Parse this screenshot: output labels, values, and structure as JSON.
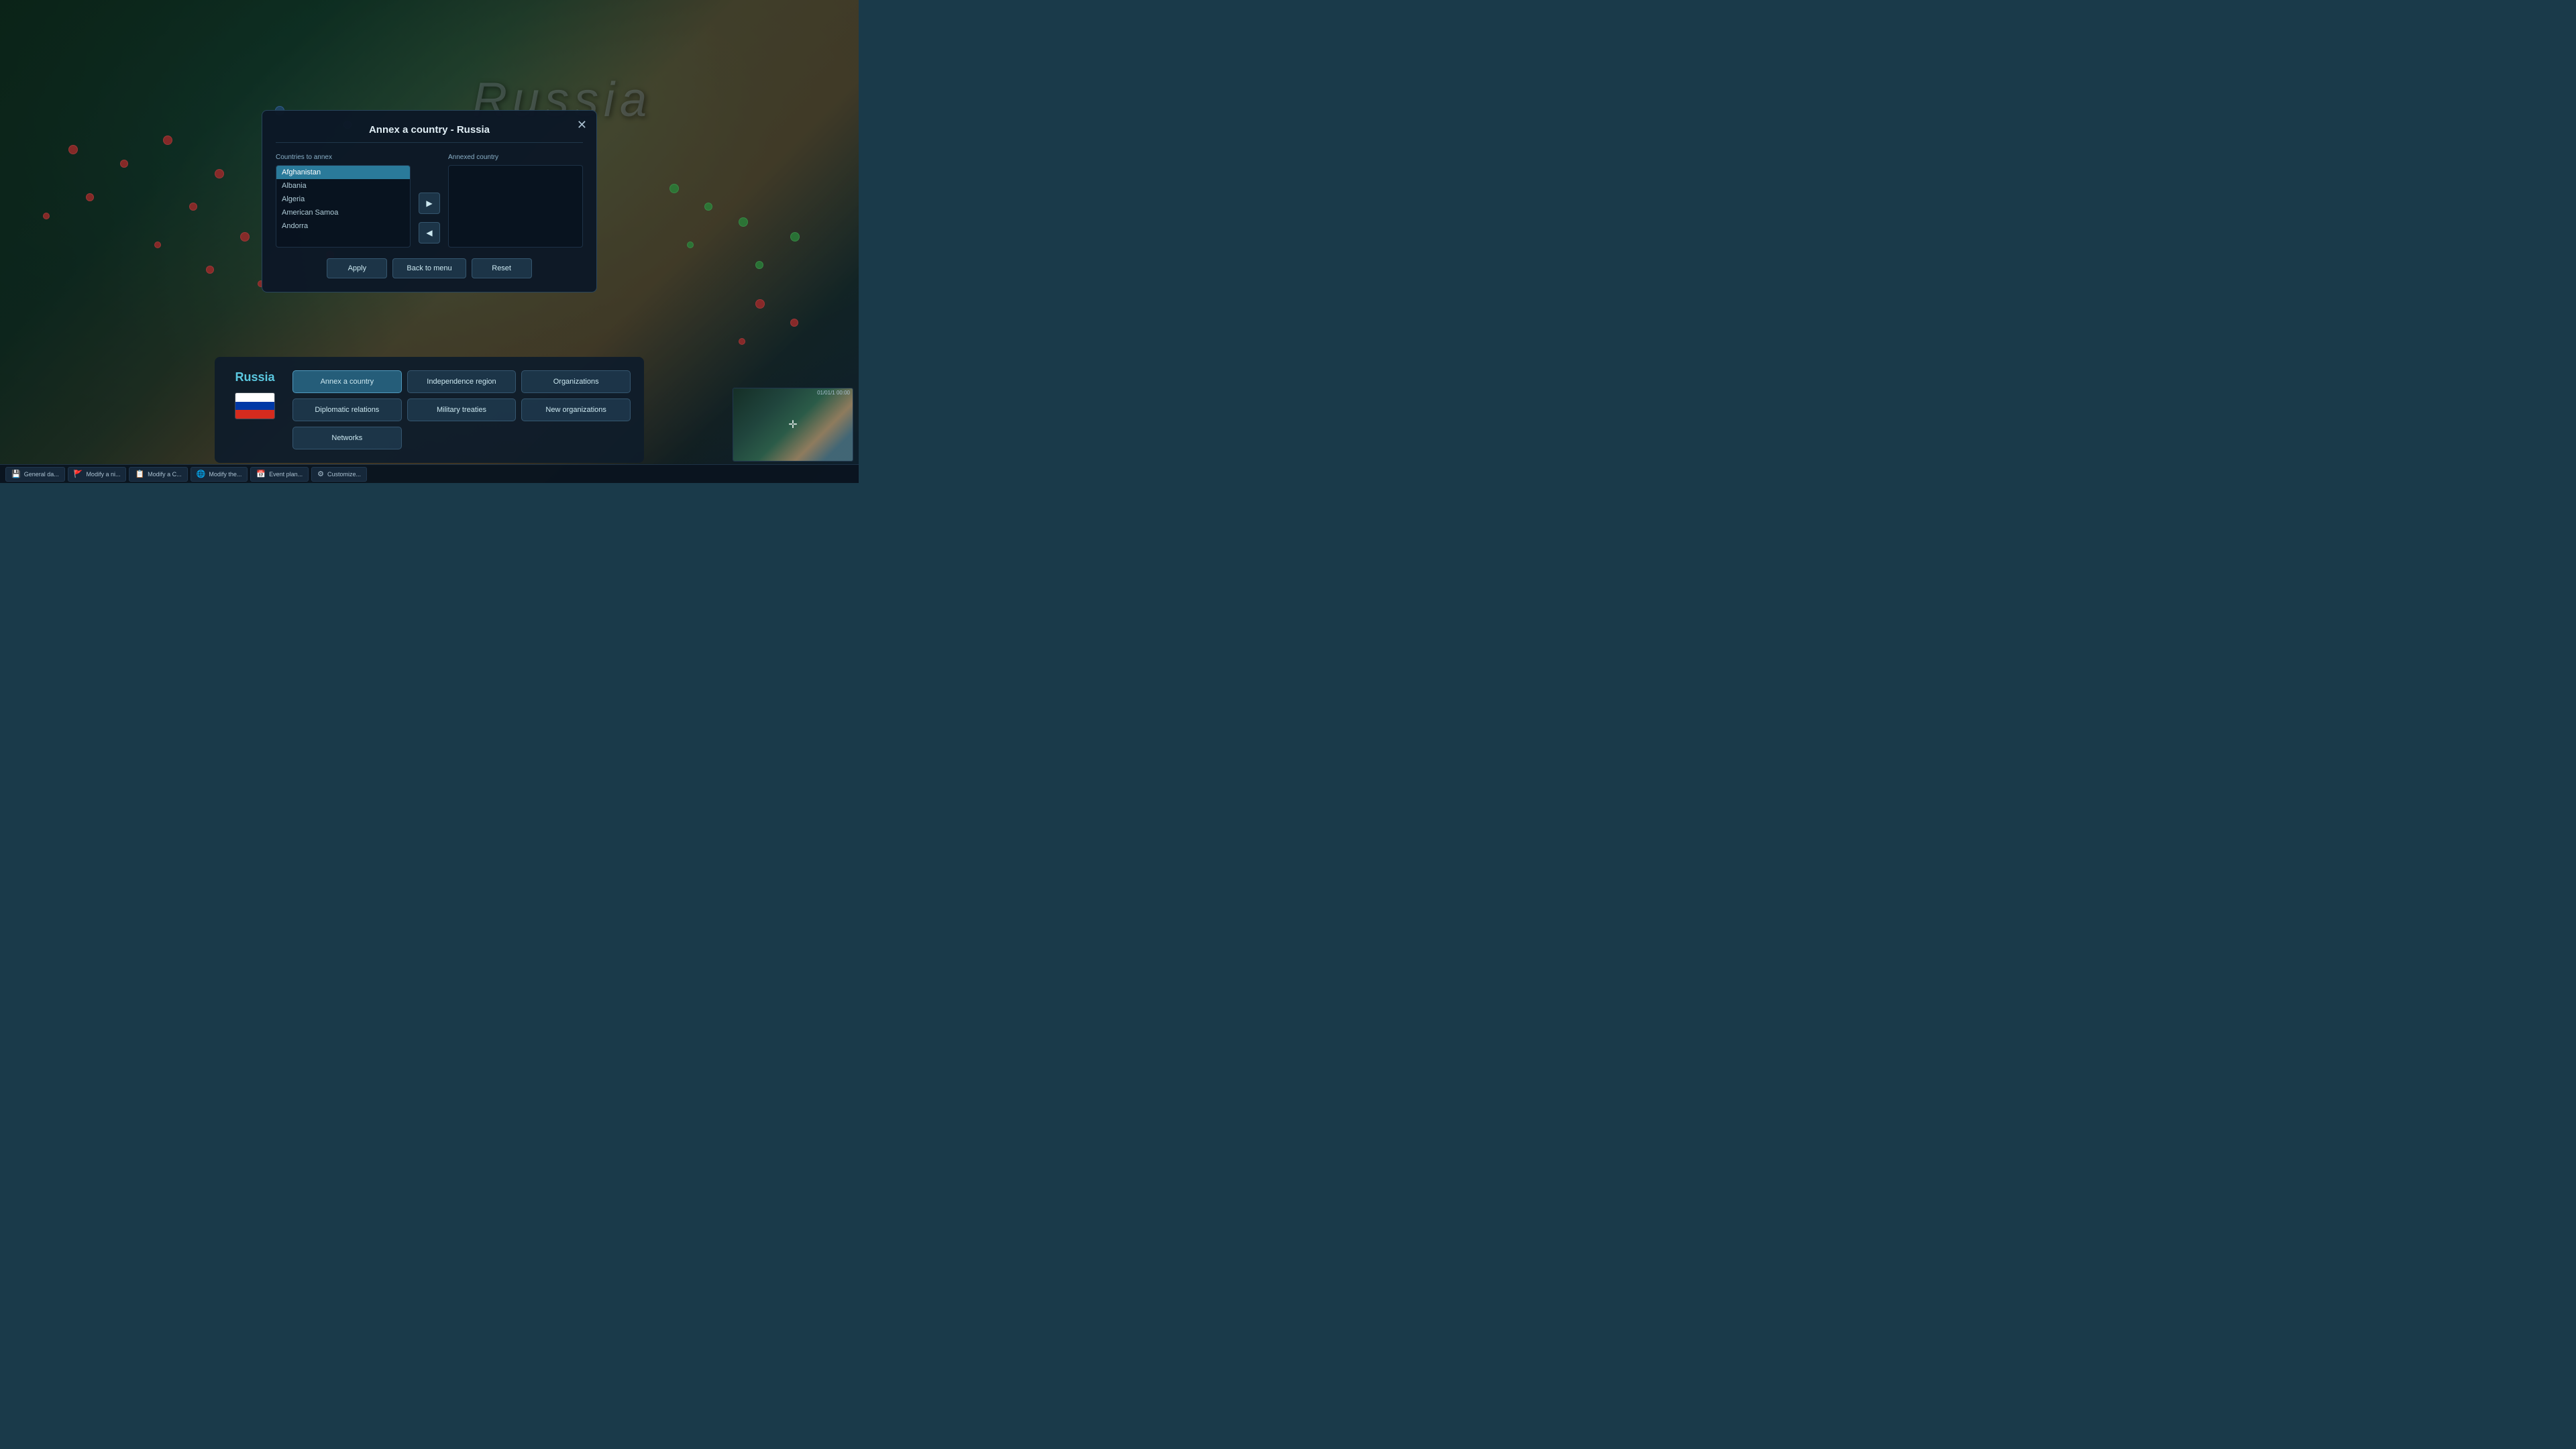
{
  "map": {
    "russia_label": "Russia"
  },
  "dialog": {
    "title": "Annex a country - Russia",
    "close_label": "✕",
    "countries_to_annex_header": "Countries to annex",
    "annexed_country_header": "Annexed country",
    "countries_list": [
      {
        "name": "Afghanistan",
        "selected": true
      },
      {
        "name": "Albania",
        "selected": false
      },
      {
        "name": "Algeria",
        "selected": false
      },
      {
        "name": "American Samoa",
        "selected": false
      },
      {
        "name": "Andorra",
        "selected": false
      }
    ],
    "annexed_list": [],
    "apply_label": "Apply",
    "back_to_menu_label": "Back to menu",
    "reset_label": "Reset"
  },
  "bottom_panel": {
    "country_name": "Russia",
    "buttons": [
      {
        "label": "Annex a country",
        "active": true,
        "id": "annex"
      },
      {
        "label": "Independence region",
        "active": false,
        "id": "independence"
      },
      {
        "label": "Organizations",
        "active": false,
        "id": "organizations"
      },
      {
        "label": "Diplomatic relations",
        "active": false,
        "id": "diplomatic"
      },
      {
        "label": "Military treaties",
        "active": false,
        "id": "military"
      },
      {
        "label": "New organizations",
        "active": false,
        "id": "new-orgs"
      },
      {
        "label": "Networks",
        "active": false,
        "id": "networks"
      }
    ]
  },
  "taskbar": {
    "items": [
      {
        "label": "General da...",
        "icon": "💾",
        "id": "general"
      },
      {
        "label": "Modify a ni...",
        "icon": "🚩",
        "id": "modify-ni"
      },
      {
        "label": "Modify a C...",
        "icon": "📋",
        "id": "modify-c"
      },
      {
        "label": "Modify the...",
        "icon": "🌐",
        "id": "modify-the"
      },
      {
        "label": "Event plan...",
        "icon": "📅",
        "id": "event"
      },
      {
        "label": "Customize...",
        "icon": "⚙",
        "id": "customize"
      }
    ]
  },
  "minimap": {
    "time": "01/01/1 00:00"
  }
}
